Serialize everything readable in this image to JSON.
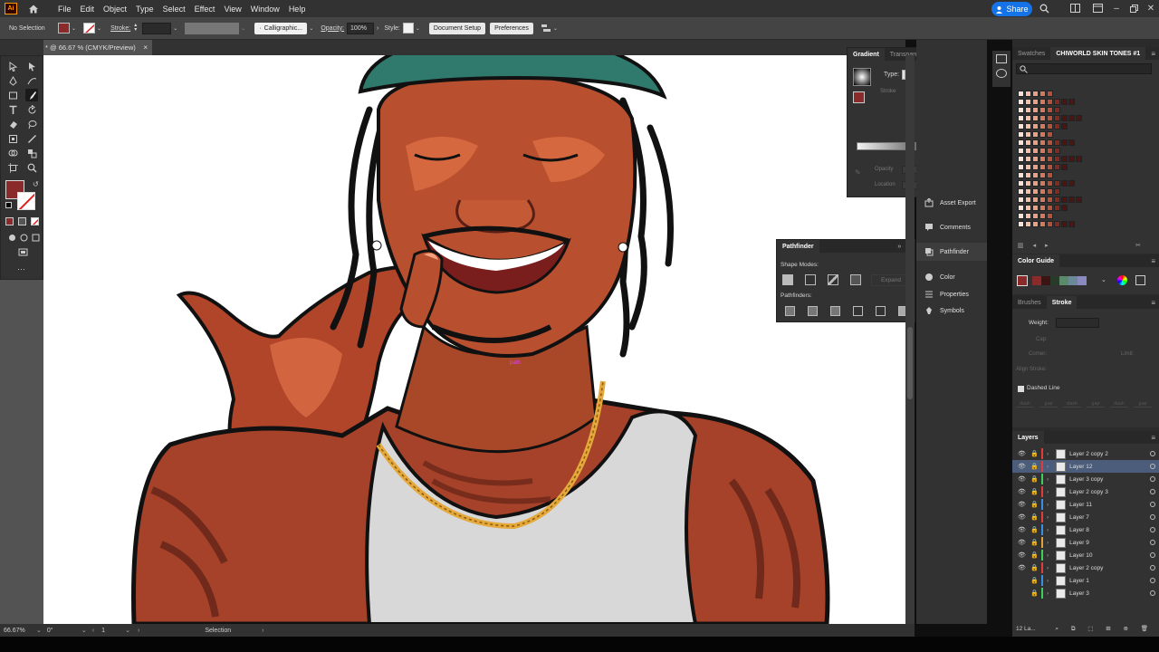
{
  "menu": {
    "app_logo": "Ai",
    "items": [
      "File",
      "Edit",
      "Object",
      "Type",
      "Select",
      "Effect",
      "View",
      "Window",
      "Help"
    ],
    "share_label": "Share"
  },
  "control_bar": {
    "selection": "No Selection",
    "stroke_label": "Stroke:",
    "brush": "Calligraphic...",
    "opacity_label": "Opacity:",
    "opacity_value": "100%",
    "style_label": "Style:",
    "document_setup": "Document Setup",
    "preferences": "Preferences",
    "fill_color": "#8b2a2a"
  },
  "document": {
    "tab_title": "* @ 66.67 % (CMYK/Preview)",
    "close": "×"
  },
  "canvas": {
    "path_label": "path"
  },
  "status": {
    "zoom": "66.67%",
    "rotation": "0°",
    "artboard": "1",
    "tool": "Selection"
  },
  "gradient_panel": {
    "tabs": [
      "Gradient",
      "Transparency"
    ],
    "type_label": "Type:",
    "stroke_label": "Stroke",
    "opacity_label": "Opacity",
    "location_label": "Location"
  },
  "pathfinder_panel": {
    "title": "Pathfinder",
    "shape_modes": "Shape Modes:",
    "pathfinders": "Pathfinders:",
    "expand": "Expand"
  },
  "dock": {
    "items": [
      "Asset Export",
      "Comments",
      "Pathfinder",
      "Color",
      "Properties",
      "Symbols"
    ]
  },
  "swatches_panel": {
    "tabs": [
      "Swatches",
      "CHIWORLD SKIN TONES #1"
    ]
  },
  "color_guide": {
    "title": "Color Guide"
  },
  "stroke_panel": {
    "tabs": [
      "Brushes",
      "Stroke"
    ],
    "weight_label": "Weight:",
    "cap_label": "Cap:",
    "corner_label": "Corner:",
    "limit_label": "Limit:",
    "align_label": "Align Stroke:",
    "dashed_line": "Dashed Line",
    "dash_labels": [
      "dash",
      "gap",
      "dash",
      "gap",
      "dash",
      "gap"
    ]
  },
  "layers_panel": {
    "title": "Layers",
    "footer": "12 La...",
    "layers": [
      {
        "name": "Layer 2 copy 2",
        "color": "#e23b3b",
        "visible": true,
        "selected": false
      },
      {
        "name": "Layer 12",
        "color": "#e23b3b",
        "visible": true,
        "selected": true
      },
      {
        "name": "Layer 3 copy",
        "color": "#3ccf5a",
        "visible": true,
        "selected": false
      },
      {
        "name": "Layer 2 copy 3",
        "color": "#e23b3b",
        "visible": true,
        "selected": false
      },
      {
        "name": "Layer 11",
        "color": "#3a8ee6",
        "visible": true,
        "selected": false
      },
      {
        "name": "Layer 7",
        "color": "#e23b3b",
        "visible": true,
        "selected": false
      },
      {
        "name": "Layer 8",
        "color": "#3a8ee6",
        "visible": true,
        "selected": false
      },
      {
        "name": "Layer 9",
        "color": "#e2a23b",
        "visible": true,
        "selected": false
      },
      {
        "name": "Layer 10",
        "color": "#3ccf5a",
        "visible": true,
        "selected": false
      },
      {
        "name": "Layer 2 copy",
        "color": "#e23b3b",
        "visible": true,
        "selected": false
      },
      {
        "name": "Layer 1",
        "color": "#3a8ee6",
        "visible": false,
        "selected": false
      },
      {
        "name": "Layer 3",
        "color": "#3ccf5a",
        "visible": false,
        "selected": false
      }
    ]
  }
}
